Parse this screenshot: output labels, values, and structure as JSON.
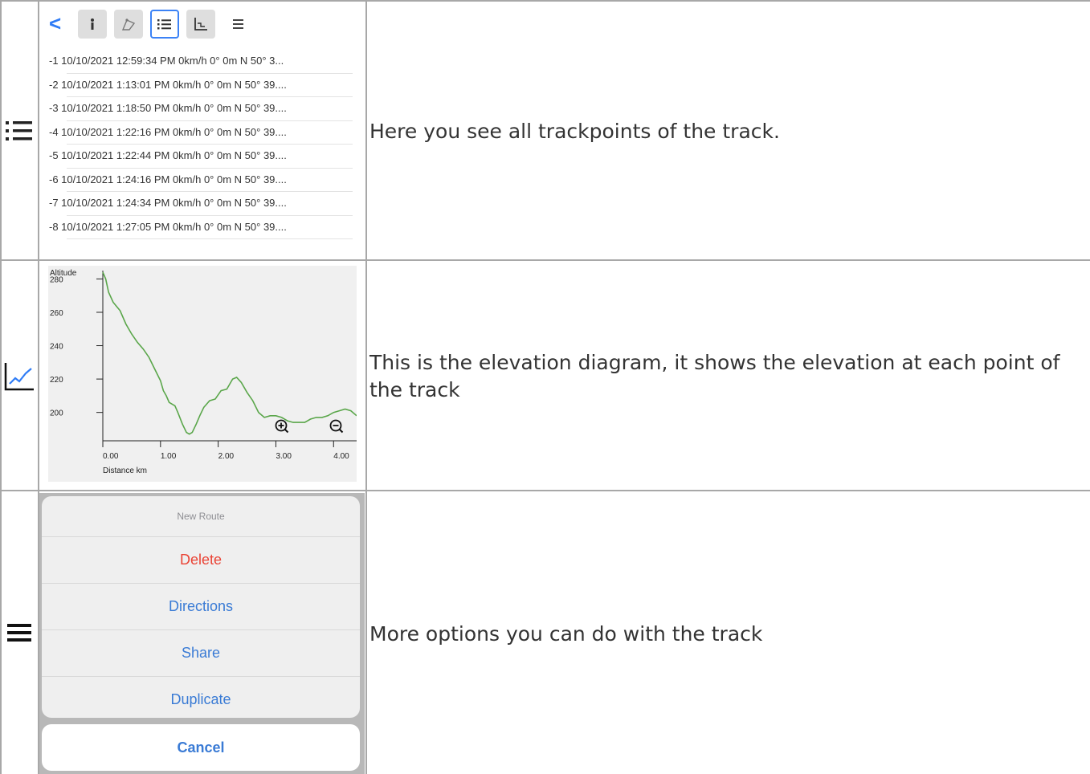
{
  "rows": [
    {
      "icon": "list-icon",
      "description": "Here you see all trackpoints of the track."
    },
    {
      "icon": "elevation-chart-icon",
      "description": "This is the elevation diagram, it shows the elevation at each point of the track"
    },
    {
      "icon": "menu-icon",
      "description": "More options you can do with the track"
    }
  ],
  "track_screen": {
    "back_label": "<",
    "toolbar_icons": [
      "info-icon",
      "route-icon",
      "list-icon",
      "chart-icon",
      "menu-icon"
    ],
    "active_tab": "list-icon",
    "trackpoints": [
      "-1  10/10/2021 12:59:34 PM  0km/h 0° 0m N 50° 3...",
      "-2  10/10/2021 1:13:01 PM  0km/h 0° 0m N 50° 39....",
      "-3  10/10/2021 1:18:50 PM  0km/h 0° 0m N 50° 39....",
      "-4  10/10/2021 1:22:16 PM  0km/h 0° 0m N 50° 39....",
      "-5  10/10/2021 1:22:44 PM  0km/h 0° 0m N 50° 39....",
      "-6  10/10/2021 1:24:16 PM  0km/h 0° 0m N 50° 39....",
      "-7  10/10/2021 1:24:34 PM  0km/h 0° 0m N 50° 39....",
      "-8  10/10/2021 1:27:05 PM  0km/h 0° 0m N 50° 39...."
    ]
  },
  "chart_data": {
    "type": "line",
    "title": "",
    "ylabel": "Altitude",
    "xlabel": "Distance km",
    "xlim": [
      0,
      4.4
    ],
    "ylim": [
      183,
      285
    ],
    "xticks": [
      0,
      1,
      2,
      3,
      4
    ],
    "xtick_labels": [
      "0.00",
      "1.00",
      "2.00",
      "3.00",
      "4.00"
    ],
    "yticks": [
      200,
      220,
      240,
      260,
      280
    ],
    "ytick_labels": [
      "200",
      "220",
      "240",
      "260",
      "280"
    ],
    "grid": false,
    "line_color": "#5aa64a",
    "x": [
      0.0,
      0.05,
      0.1,
      0.18,
      0.3,
      0.4,
      0.5,
      0.6,
      0.7,
      0.8,
      0.9,
      1.0,
      1.05,
      1.1,
      1.15,
      1.25,
      1.3,
      1.38,
      1.45,
      1.5,
      1.55,
      1.62,
      1.68,
      1.75,
      1.85,
      1.95,
      2.05,
      2.15,
      2.25,
      2.32,
      2.4,
      2.5,
      2.6,
      2.7,
      2.8,
      2.9,
      3.0,
      3.1,
      3.2,
      3.3,
      3.4,
      3.5,
      3.6,
      3.7,
      3.8,
      3.9,
      4.0,
      4.1,
      4.2,
      4.3,
      4.4
    ],
    "y": [
      284,
      280,
      272,
      266,
      261,
      253,
      247,
      242,
      238,
      233,
      226,
      219,
      213,
      210,
      206,
      204,
      200,
      193,
      188,
      187,
      188,
      193,
      198,
      203,
      207,
      208,
      213,
      214,
      220,
      221,
      218,
      212,
      207,
      200,
      197,
      198,
      198,
      197,
      195,
      194,
      194,
      194,
      196,
      197,
      197,
      198,
      200,
      201,
      202,
      201,
      198
    ],
    "zoom_in_icon": "zoom-in-icon",
    "zoom_out_icon": "zoom-out-icon"
  },
  "action_sheet": {
    "title": "New Route",
    "items": [
      {
        "label": "Delete",
        "style": "destructive"
      },
      {
        "label": "Directions",
        "style": "default"
      },
      {
        "label": "Share",
        "style": "default"
      },
      {
        "label": "Duplicate",
        "style": "default"
      }
    ],
    "cancel_label": "Cancel",
    "accent_color": "#3a7bd5",
    "destructive_color": "#ea4335"
  }
}
